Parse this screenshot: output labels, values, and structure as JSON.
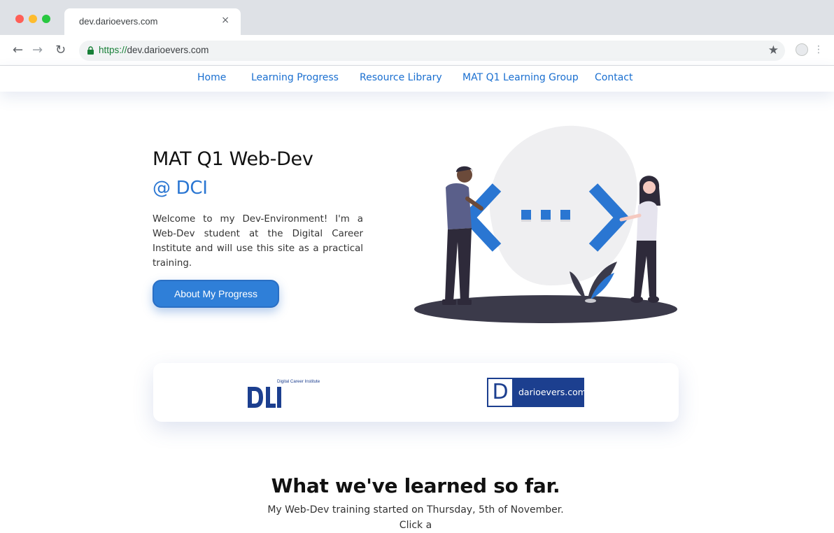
{
  "browser": {
    "tab_title": "dev.darioevers.com",
    "tab_close": "×",
    "url_scheme": "https://",
    "url_host": "dev.darioevers.com"
  },
  "nav": {
    "items": [
      {
        "label": "Home"
      },
      {
        "label": "Learning Progress"
      },
      {
        "label": "Resource Library"
      },
      {
        "label": "MAT Q1 Learning Group"
      },
      {
        "label": "Contact"
      }
    ]
  },
  "hero": {
    "title": "MAT Q1 Web-Dev",
    "subtitle": "@ DCI",
    "text": "Welcome to my Dev-Environment! I'm a Web-Dev student at the Digital Career Institute and will use this site as a practical training.",
    "button_label": "About My Progress"
  },
  "logos": {
    "dci_caption": "Digital Career Institute",
    "dci_mark": "DCI",
    "dario_letter": "D",
    "dario_text": "darioevers.com"
  },
  "section": {
    "title": "What we've learned so far.",
    "text": "My Web-Dev training started on Thursday, 5th of November. Click a"
  },
  "colors": {
    "accent": "#2a76d2",
    "nav_link": "#1a6fd0",
    "button": "#2f7fd8",
    "dario_brand": "#1c3f8f"
  }
}
